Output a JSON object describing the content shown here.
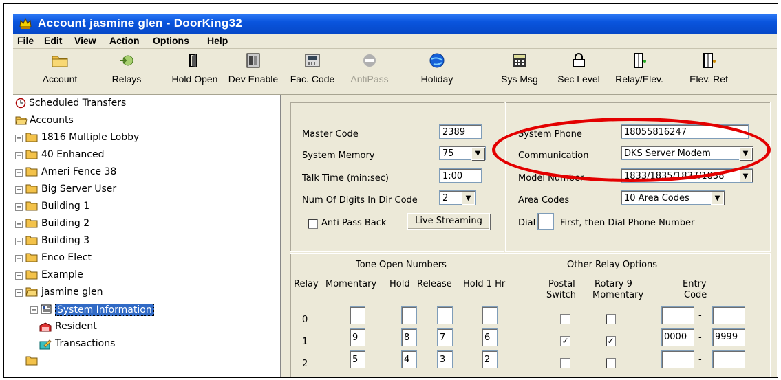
{
  "window": {
    "title": "Account jasmine glen - DoorKing32"
  },
  "menu": [
    "File",
    "Edit",
    "View",
    "Action",
    "Options",
    "Help"
  ],
  "toolbar": [
    {
      "label": "Account",
      "icon": "folder-icon"
    },
    {
      "label": "Relays",
      "icon": "relays-icon"
    },
    {
      "label": "Hold Open",
      "icon": "door-icon"
    },
    {
      "label": "Dev Enable",
      "icon": "device-icon"
    },
    {
      "label": "Fac. Code",
      "icon": "facility-code-icon"
    },
    {
      "label": "AntiPass",
      "icon": "antipass-icon",
      "disabled": true
    },
    {
      "label": "Holiday",
      "icon": "globe-icon"
    },
    {
      "label": "Sys Msg",
      "icon": "keypad-icon"
    },
    {
      "label": "Sec Level",
      "icon": "lock-icon"
    },
    {
      "label": "Relay/Elev.",
      "icon": "elevator-icon"
    },
    {
      "label": "Elev. Ref",
      "icon": "elevator-ref-icon"
    }
  ],
  "tree": {
    "scheduled": "Scheduled Transfers",
    "accounts": "Accounts",
    "items": [
      "1816 Multiple Lobby",
      "40 Enhanced",
      "Ameri Fence 38",
      "Big Server User",
      "Building 1",
      "Building 2",
      "Building 3",
      "Enco Elect",
      "Example",
      "jasmine glen"
    ],
    "children": [
      "System Information",
      "Resident",
      "Transactions"
    ]
  },
  "system": {
    "master_code_label": "Master Code",
    "master_code": "2389",
    "memory_label": "System Memory",
    "memory": "75",
    "talk_time_label": "Talk Time (min:sec)",
    "talk_time": "1:00",
    "digits_label": "Num Of Digits In Dir Code",
    "digits": "2",
    "anti_pass_label": "Anti Pass Back",
    "live_streaming": "Live Streaming",
    "phone_label": "System Phone",
    "phone": "18055816247",
    "comm_label": "Communication",
    "comm": "DKS Server Modem",
    "model_label": "Model Number",
    "model": "1833/1835/1837/1838",
    "area_label": "Area Codes",
    "area": "10 Area Codes",
    "dial_label": "Dial",
    "dial_suffix": "First, then Dial Phone Number"
  },
  "tone": {
    "header": "Tone Open  Numbers",
    "cols": [
      "Relay",
      "Momentary",
      "Hold",
      "Release",
      "Hold 1 Hr"
    ],
    "rows": [
      {
        "relay": "0",
        "momentary": "",
        "hold": "",
        "release": "",
        "hold1": ""
      },
      {
        "relay": "1",
        "momentary": "9",
        "hold": "8",
        "release": "7",
        "hold1": "6"
      },
      {
        "relay": "2",
        "momentary": "5",
        "hold": "4",
        "release": "3",
        "hold1": "2"
      }
    ]
  },
  "other": {
    "header": "Other Relay Options",
    "postal_1": "Postal",
    "postal_2": "Switch",
    "rotary_1": "Rotary 9",
    "rotary_2": "Momentary",
    "entry_1": "Entry",
    "entry_2": "Code",
    "dash": "-",
    "rows": [
      {
        "postal": false,
        "rotary": false,
        "from": "",
        "to": ""
      },
      {
        "postal": true,
        "rotary": true,
        "from": "0000",
        "to": "9999"
      },
      {
        "postal": false,
        "rotary": false,
        "from": "",
        "to": ""
      }
    ]
  },
  "colors": {
    "titlebar": "#0a55de",
    "selection": "#316ac5",
    "annotation": "#e30000"
  }
}
